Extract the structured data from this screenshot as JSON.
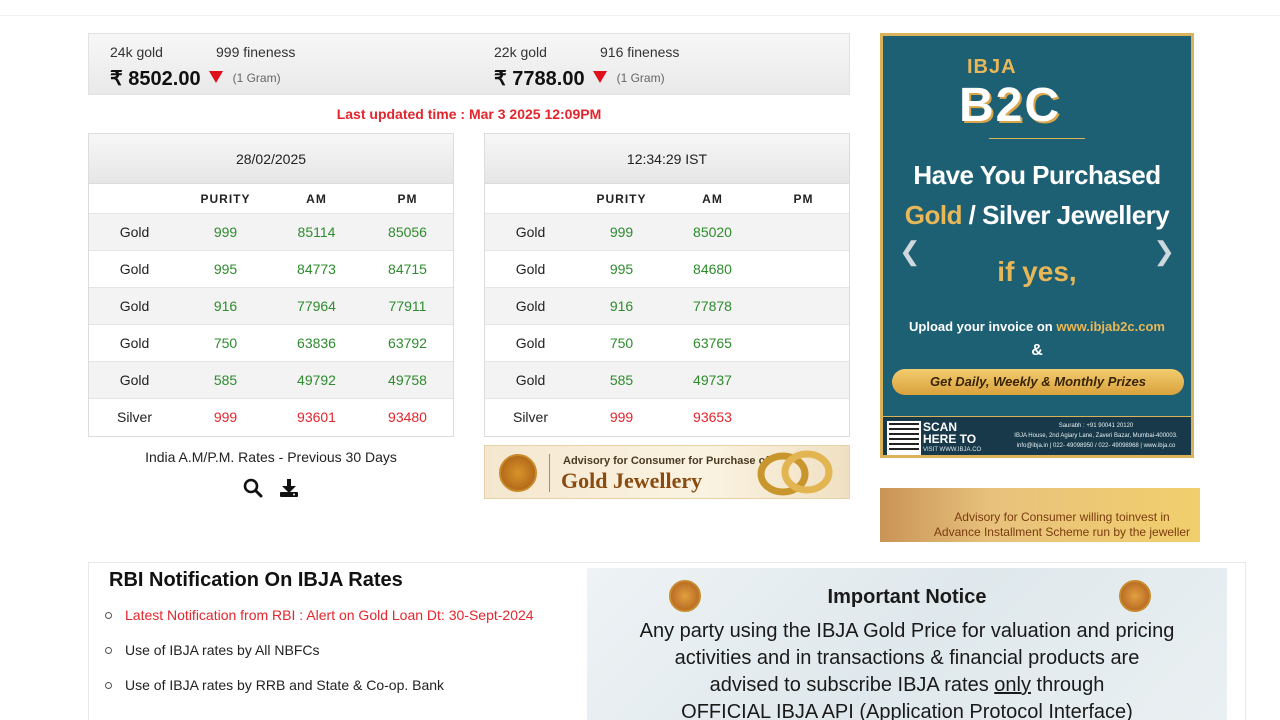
{
  "prices": [
    {
      "purity_label": "24k gold",
      "fineness_label": "999 fineness",
      "value": "₹ 8502.00",
      "unit": "(1 Gram)"
    },
    {
      "purity_label": "22k gold",
      "fineness_label": "916 fineness",
      "value": "₹ 7788.00",
      "unit": "(1 Gram)"
    }
  ],
  "last_updated": "Last updated time : Mar 3 2025 12:09PM",
  "tables": [
    {
      "header": "28/02/2025",
      "columns": [
        "",
        "PURITY",
        "AM",
        "PM"
      ],
      "rows": [
        {
          "metal": "Gold",
          "purity": "999",
          "am": "85114",
          "pm": "85056"
        },
        {
          "metal": "Gold",
          "purity": "995",
          "am": "84773",
          "pm": "84715"
        },
        {
          "metal": "Gold",
          "purity": "916",
          "am": "77964",
          "pm": "77911"
        },
        {
          "metal": "Gold",
          "purity": "750",
          "am": "63836",
          "pm": "63792"
        },
        {
          "metal": "Gold",
          "purity": "585",
          "am": "49792",
          "pm": "49758"
        },
        {
          "metal": "Silver",
          "purity": "999",
          "am": "93601",
          "pm": "93480"
        }
      ]
    },
    {
      "header": "12:34:29 IST",
      "columns": [
        "",
        "PURITY",
        "AM",
        "PM"
      ],
      "rows": [
        {
          "metal": "Gold",
          "purity": "999",
          "am": "85020",
          "pm": ""
        },
        {
          "metal": "Gold",
          "purity": "995",
          "am": "84680",
          "pm": ""
        },
        {
          "metal": "Gold",
          "purity": "916",
          "am": "77878",
          "pm": ""
        },
        {
          "metal": "Gold",
          "purity": "750",
          "am": "63765",
          "pm": ""
        },
        {
          "metal": "Gold",
          "purity": "585",
          "am": "49737",
          "pm": ""
        },
        {
          "metal": "Silver",
          "purity": "999",
          "am": "93653",
          "pm": ""
        }
      ]
    }
  ],
  "history_link": "India A.M/P.M. Rates - Previous 30 Days",
  "icons": {
    "search": "search-icon",
    "download": "download-icon"
  },
  "advisory_jewellery": {
    "line1": "Advisory for Consumer for Purchase of",
    "line2": "Gold Jewellery"
  },
  "advisory_installment": {
    "line1": "Advisory for Consumer willing toinvest in",
    "line2": "Advance Installment Scheme run by the jeweller"
  },
  "ad": {
    "logo_top": "IBJA",
    "logo_main": "B2C",
    "headline_1": "Have You Purchased",
    "headline_2_gold": "Gold",
    "headline_2_rest": " / Silver Jewellery",
    "if_yes": "if yes,",
    "upload_prefix": "Upload your invoice on ",
    "upload_url": "www.ibjab2c.com",
    "amp": "&",
    "prizes": "Get Daily, Weekly & Monthly Prizes",
    "scan_1": "SCAN",
    "scan_2": "HERE TO",
    "visit": "VISIT WWW.IBJA.CO",
    "contact_1": "Saurabh : +91 90041 20120",
    "contact_2": "IBJA House, 2nd Agiary Lane, Zaveri Bazar, Mumbai-400003.",
    "contact_3": "info@ibja.in | 022- 49098950 / 022- 49098968 | www.ibja.co"
  },
  "rbi": {
    "title": "RBI Notification On IBJA Rates",
    "items": [
      "Latest Notification from RBI : Alert on Gold Loan Dt: 30-Sept-2024",
      "Use of IBJA rates by All NBFCs",
      "Use of IBJA rates by RRB and State & Co-op. Bank"
    ]
  },
  "notice": {
    "title": "Important Notice",
    "line1": "Any party using the IBJA Gold Price for valuation and pricing",
    "line2": "activities and in transactions & financial products are",
    "line3_pre": "advised to subscribe IBJA rates ",
    "line3_u": "only",
    "line3_post": " through",
    "line4": "OFFICIAL IBJA API (Application Protocol Interface)"
  },
  "colors": {
    "accent_red": "#e3262d",
    "value_green": "#2e8b2e",
    "ad_teal": "#1d5f73",
    "ad_gold": "#e8b757"
  }
}
